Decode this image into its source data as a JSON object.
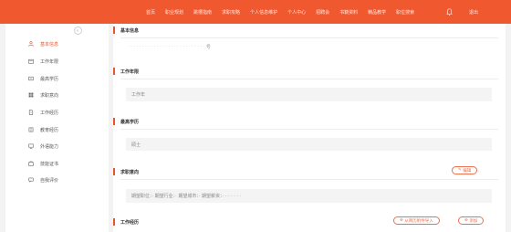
{
  "nav": {
    "items": [
      "首页",
      "职业规划",
      "跳槽指南",
      "求职攻略",
      "个人信息维护",
      "个人中心",
      "招聘会",
      "书籍资料",
      "精品教学",
      "职位搜索"
    ],
    "user": "退出"
  },
  "sidebar": {
    "items": [
      {
        "label": "基本信息",
        "icon": "user-icon",
        "active": true
      },
      {
        "label": "工作年限",
        "icon": "calendar-icon"
      },
      {
        "label": "最高学历",
        "icon": "education-icon"
      },
      {
        "label": "求职意向",
        "icon": "grid-icon"
      },
      {
        "label": "工作经历",
        "icon": "document-icon"
      },
      {
        "label": "教育经历",
        "icon": "book-icon"
      },
      {
        "label": "外语能力",
        "icon": "monitor-icon"
      },
      {
        "label": "技能证书",
        "icon": "certificate-icon"
      },
      {
        "label": "自我评价",
        "icon": "comment-icon"
      }
    ]
  },
  "basic_info": {
    "title": "基本信息",
    "value": "号"
  },
  "work_years": {
    "title": "工作年限",
    "label": "工作年"
  },
  "education": {
    "title": "最高学历",
    "value": "硕士"
  },
  "intention": {
    "title": "求职意向",
    "edit_label": "编辑",
    "text": "期望职位：· 期望行业：· 期望城市：· 期望薪资：· · · · · · ·"
  },
  "work_history": {
    "title": "工作经历",
    "import_label": "从简历附件导入",
    "add_label": "添加"
  },
  "colors": {
    "accent": "#f0582f"
  }
}
